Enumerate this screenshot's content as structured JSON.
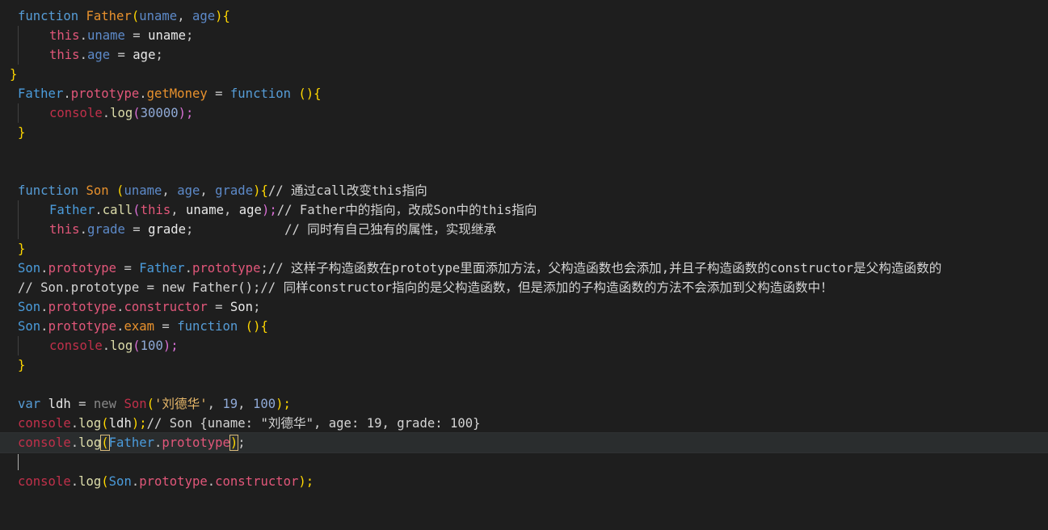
{
  "lines": [
    [
      "function ",
      "Father",
      "(",
      "uname",
      ", ",
      "age",
      "){"
    ],
    [
      "this",
      ".",
      "uname",
      " = ",
      "uname",
      ";"
    ],
    [
      "this",
      ".",
      "age",
      " = ",
      "age",
      ";"
    ],
    [
      "}"
    ],
    [
      "Father",
      ".",
      "prototype",
      ".",
      "getMoney",
      " = ",
      "function",
      " (){"
    ],
    [
      "console",
      ".",
      "log",
      "(",
      "30000",
      ");"
    ],
    [
      "}"
    ],
    [
      ""
    ],
    [
      ""
    ],
    [
      "function ",
      "Son",
      " (",
      "uname",
      ", ",
      "age",
      ", ",
      "grade",
      "){",
      "// 通过call改变this指向"
    ],
    [
      "Father",
      ".",
      "call",
      "(",
      "this",
      ", ",
      "uname",
      ", ",
      "age",
      ");",
      "// Father中的指向，改成Son中的this指向"
    ],
    [
      "this",
      ".",
      "grade",
      " = ",
      "grade",
      ";",
      "            // 同时有自己独有的属性，实现继承"
    ],
    [
      "}"
    ],
    [
      "Son",
      ".",
      "prototype",
      " = ",
      "Father",
      ".",
      "prototype",
      ";",
      "// 这样子构造函数在prototype里面添加方法，父构造函数也会添加,并且子构造函数的constructor是父构造函数的"
    ],
    [
      "// Son.prototype = new Father();// 同样constructor指向的是父构造函数，但是添加的子构造函数的方法不会添加到父构造函数中！"
    ],
    [
      "Son",
      ".",
      "prototype",
      ".",
      "constructor",
      " = ",
      "Son",
      ";"
    ],
    [
      "Son",
      ".",
      "prototype",
      ".",
      "exam",
      " = ",
      "function",
      " (){"
    ],
    [
      "console",
      ".",
      "log",
      "(",
      "100",
      ");"
    ],
    [
      "}"
    ],
    [
      ""
    ],
    [
      "var ",
      "ldh",
      " = ",
      "new ",
      "Son",
      "(",
      "'刘德华'",
      ", ",
      "19",
      ", ",
      "100",
      ");"
    ],
    [
      "console",
      ".",
      "log",
      "(",
      "ldh",
      ");",
      "// Son {uname: \"刘德华\", age: 19, grade: 100}"
    ],
    [
      "console",
      ".",
      "log",
      "(",
      "Father",
      ".",
      "prototype",
      ")",
      ";"
    ],
    [
      ""
    ],
    [
      "console",
      ".",
      "log",
      "(",
      "Son",
      ".",
      "prototype",
      ".",
      "constructor",
      ");"
    ]
  ]
}
